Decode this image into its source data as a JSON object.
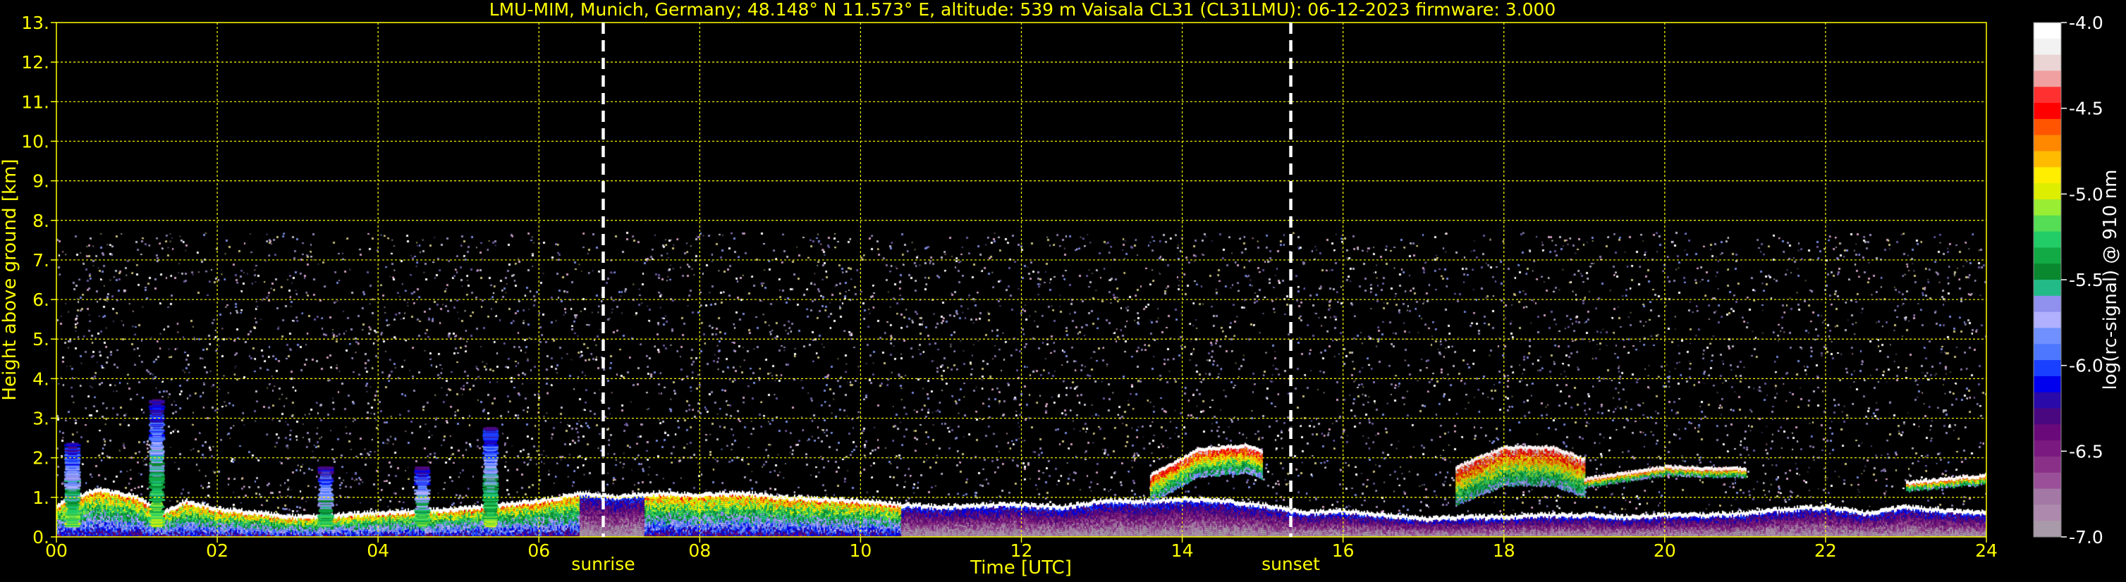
{
  "chart_data": {
    "type": "heatmap",
    "title": "LMU-MIM, Munich, Germany; 48.148° N 11.573° E, altitude: 539 m    Vaisala CL31 (CL31LMU): 06-12-2023    firmware: 3.000",
    "xlabel": "Time [UTC]",
    "ylabel": "Height above ground [km]",
    "xlim": [
      0,
      24
    ],
    "ylim": [
      0,
      13
    ],
    "x_ticks": [
      "00",
      "02",
      "04",
      "06",
      "08",
      "10",
      "12",
      "14",
      "16",
      "18",
      "20",
      "22",
      "24"
    ],
    "y_ticks": [
      "0.",
      "1.",
      "2.",
      "3.",
      "4.",
      "5.",
      "6.",
      "7.",
      "8.",
      "9.",
      "10.",
      "11.",
      "12.",
      "13."
    ],
    "grid": true,
    "grid_color": "#ffff00",
    "annotations": [
      {
        "label": "sunrise",
        "time": 6.8
      },
      {
        "label": "sunset",
        "time": 15.35
      }
    ],
    "colorbar": {
      "label": "log(rc-signal) @ 910 nm",
      "range": [
        -7.0,
        -4.0
      ],
      "ticks": [
        "-4.0",
        "-4.5",
        "-5.0",
        "-5.5",
        "-6.0",
        "-6.5",
        "-7.0"
      ],
      "colors": [
        "#ffffff",
        "#f2f2f2",
        "#ead4d4",
        "#f0a0a0",
        "#ff3030",
        "#ff0000",
        "#ff5500",
        "#ff8800",
        "#ffbb00",
        "#ffee00",
        "#ddee00",
        "#99ee33",
        "#55dd55",
        "#22cc66",
        "#11aa44",
        "#0a8830",
        "#22bb88",
        "#9090ee",
        "#b0b0ff",
        "#7090ff",
        "#4d77ff",
        "#1a40ff",
        "#0000ee",
        "#2a0aa8",
        "#4a0880",
        "#6a0a7a",
        "#7a1a80",
        "#8a3088",
        "#9a5098",
        "#a478a4",
        "#ad8aad",
        "#a99aa9"
      ]
    },
    "noise_top_km": 7.7,
    "cloud_layers": [
      {
        "t": [
          0.0,
          0.5,
          1.0,
          1.3,
          1.6,
          2.0,
          3.0,
          4.0,
          5.0,
          6.0,
          6.5,
          7.0,
          7.5,
          8.0,
          8.5,
          9.0,
          9.5,
          10.0,
          10.5,
          11.0,
          11.5,
          12.0,
          12.5,
          13.0,
          13.5,
          14.0,
          14.5,
          15.0,
          15.5,
          16.0,
          16.5,
          17.0,
          17.5,
          18.0,
          18.5,
          19.0,
          19.5,
          20.0,
          20.5,
          21.0,
          21.5,
          22.0,
          22.5,
          23.0,
          23.5,
          24.0
        ],
        "h": [
          0.8,
          1.2,
          1.0,
          0.6,
          0.9,
          0.7,
          0.5,
          0.6,
          0.7,
          0.9,
          1.1,
          1.0,
          1.1,
          1.05,
          1.1,
          1.0,
          0.95,
          0.9,
          0.8,
          0.75,
          0.8,
          0.8,
          0.75,
          0.9,
          0.9,
          0.95,
          0.9,
          0.8,
          0.6,
          0.65,
          0.55,
          0.45,
          0.5,
          0.5,
          0.55,
          0.55,
          0.5,
          0.55,
          0.55,
          0.6,
          0.7,
          0.75,
          0.6,
          0.75,
          0.65,
          0.6
        ]
      },
      {
        "t": [
          13.6,
          14.2,
          14.8,
          15.0
        ],
        "h": [
          1.6,
          2.25,
          2.35,
          2.2
        ],
        "thickness": 0.7
      },
      {
        "t": [
          17.4,
          18.0,
          18.6,
          19.0
        ],
        "h": [
          1.8,
          2.3,
          2.3,
          2.0
        ],
        "thickness": 1.0
      },
      {
        "t": [
          19.0,
          20.0,
          21.0
        ],
        "h": [
          1.5,
          1.8,
          1.75
        ],
        "thickness": 0.25
      },
      {
        "t": [
          23.0,
          23.5,
          24.0
        ],
        "h": [
          1.4,
          1.5,
          1.6
        ],
        "thickness": 0.25
      }
    ],
    "plumes": [
      {
        "t": 1.25,
        "h": 3.5
      },
      {
        "t": 0.2,
        "h": 2.4
      },
      {
        "t": 5.4,
        "h": 2.8
      },
      {
        "t": 4.55,
        "h": 1.8
      },
      {
        "t": 3.35,
        "h": 1.8
      }
    ]
  }
}
